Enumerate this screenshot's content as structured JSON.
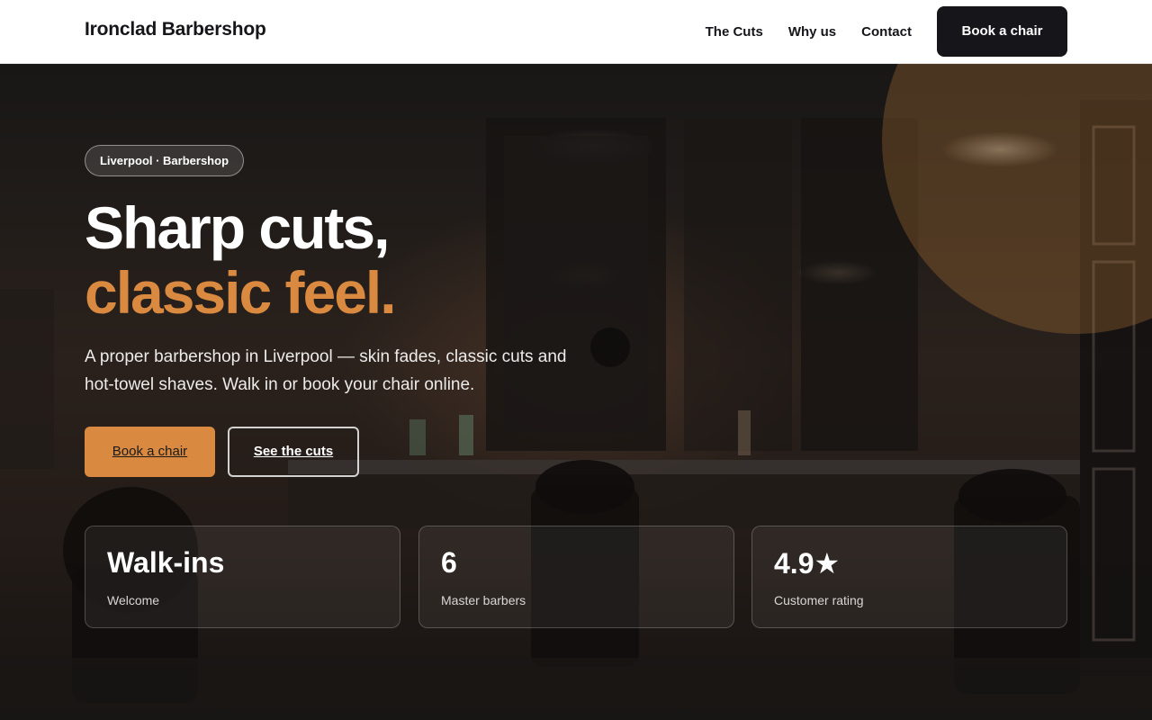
{
  "header": {
    "brand": "Ironclad Barbershop",
    "nav": [
      "The Cuts",
      "Why us",
      "Contact"
    ],
    "cta": "Book a chair"
  },
  "hero": {
    "badge": "Liverpool · Barbershop",
    "title_line1": "Sharp cuts,",
    "title_line2": "classic feel.",
    "lead": "A proper barbershop in Liverpool — skin fades, classic cuts and hot-towel shaves. Walk in or book your chair online.",
    "primary_button": "Book a chair",
    "secondary_button": "See the cuts",
    "stats": [
      {
        "value": "Walk-ins",
        "label": "Welcome"
      },
      {
        "value": "6",
        "label": "Master barbers"
      },
      {
        "value": "4.9★",
        "label": "Customer rating"
      }
    ]
  },
  "colors": {
    "accent": "#d98a40",
    "dark": "#15151a",
    "header_bg": "#ffffff"
  }
}
